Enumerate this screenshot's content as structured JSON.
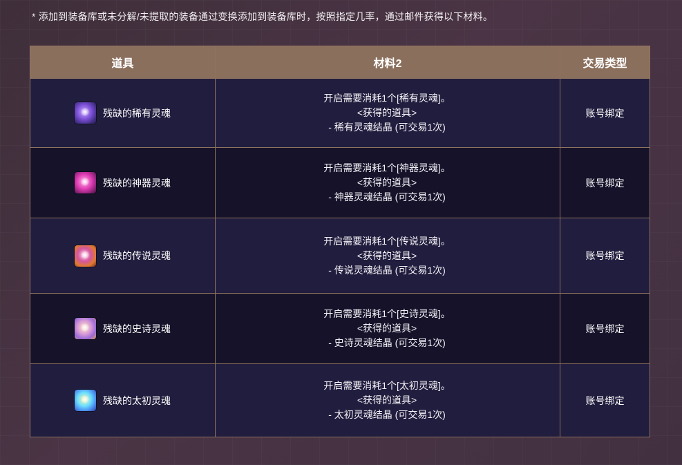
{
  "notice": "* 添加到装备库或未分解/未提取的装备通过变换添加到装备库时，按照指定几率，通过邮件获得以下材料。",
  "table": {
    "headers": [
      "道具",
      "材料2",
      "交易类型"
    ],
    "rows": [
      {
        "item": "残缺的稀有灵魂",
        "icon": "rare-soul-icon",
        "material_line1": "开启需要消耗1个[稀有灵魂]。",
        "material_line2": "<获得的道具>",
        "material_line3": "- 稀有灵魂结晶 (可交易1次)",
        "trade": "账号绑定"
      },
      {
        "item": "残缺的神器灵魂",
        "icon": "unique-soul-icon",
        "material_line1": "开启需要消耗1个[神器灵魂]。",
        "material_line2": "<获得的道具>",
        "material_line3": "- 神器灵魂结晶 (可交易1次)",
        "trade": "账号绑定"
      },
      {
        "item": "残缺的传说灵魂",
        "icon": "legendary-soul-icon",
        "material_line1": "开启需要消耗1个[传说灵魂]。",
        "material_line2": "<获得的道具>",
        "material_line3": "- 传说灵魂结晶 (可交易1次)",
        "trade": "账号绑定"
      },
      {
        "item": "残缺的史诗灵魂",
        "icon": "epic-soul-icon",
        "material_line1": "开启需要消耗1个[史诗灵魂]。",
        "material_line2": "<获得的道具>",
        "material_line3": "- 史诗灵魂结晶 (可交易1次)",
        "trade": "账号绑定"
      },
      {
        "item": "残缺的太初灵魂",
        "icon": "primeval-soul-icon",
        "material_line1": "开启需要消耗1个[太初灵魂]。",
        "material_line2": "<获得的道具>",
        "material_line3": "- 太初灵魂结晶 (可交易1次)",
        "trade": "账号绑定"
      }
    ]
  }
}
